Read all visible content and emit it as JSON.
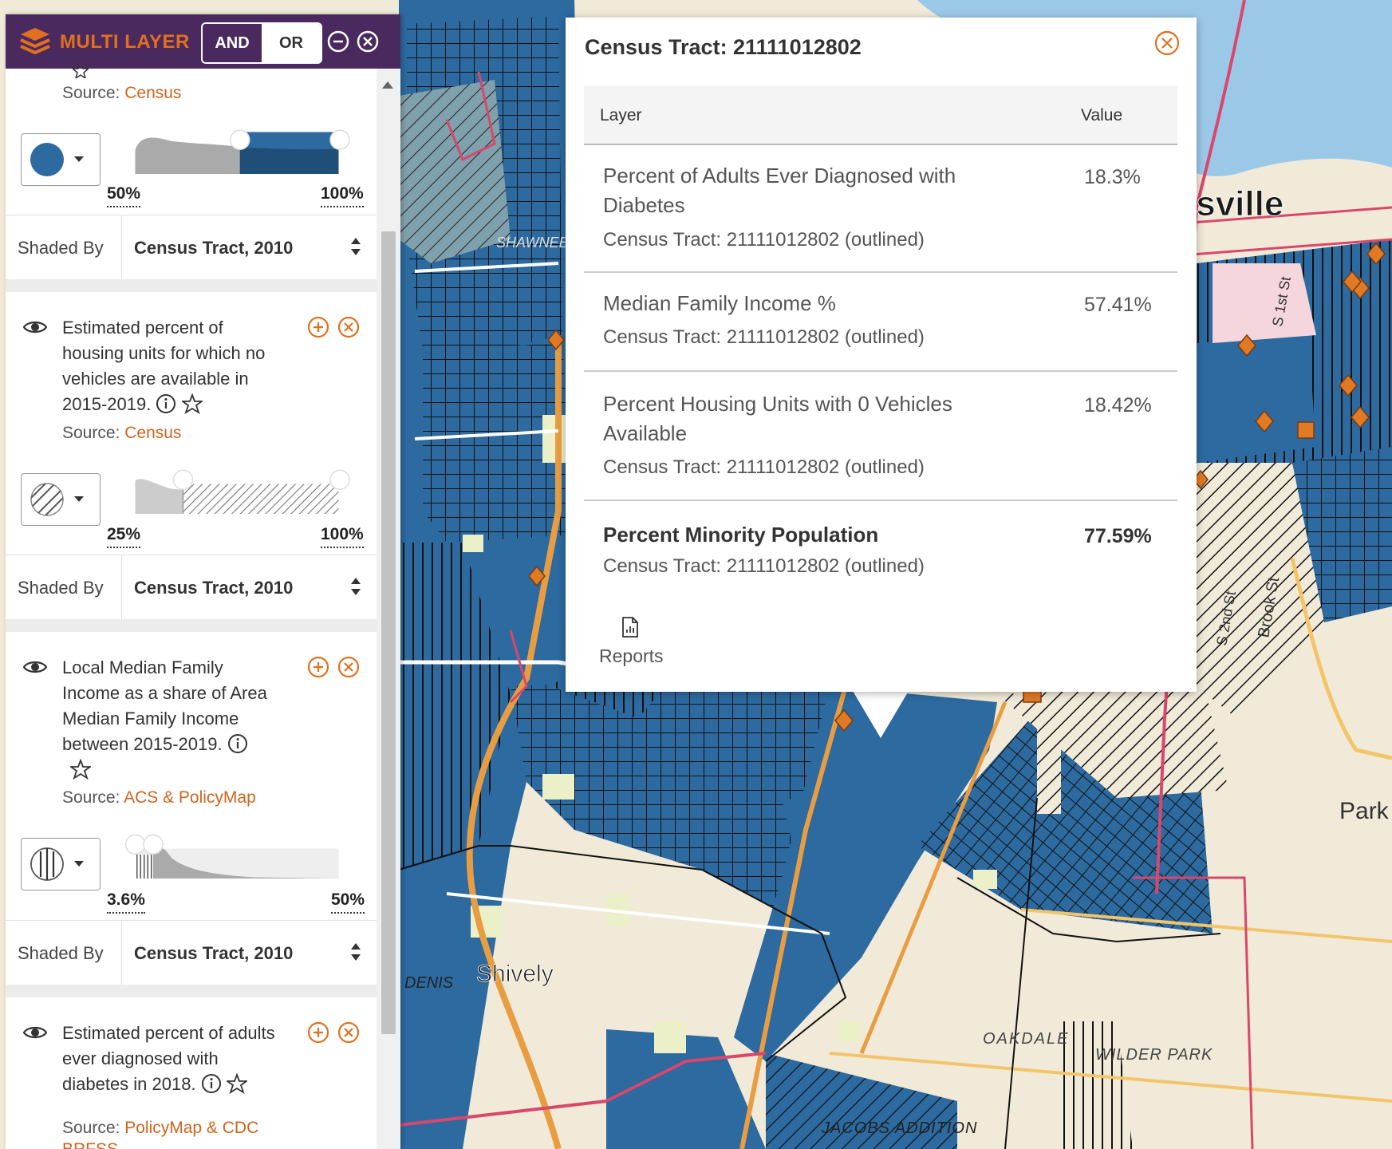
{
  "header": {
    "title": "MULTI LAYER",
    "and_label": "AND",
    "or_label": "OR"
  },
  "layers": [
    {
      "source_prefix": "Source:",
      "source": "Census",
      "min_label": "50%",
      "max_label": "100%",
      "shaded_by_label": "Shaded By",
      "shaded_by_value": "Census Tract, 2010",
      "fill": "solid"
    },
    {
      "title": "Estimated percent of housing units for which no vehicles are available in 2015-2019.",
      "source_prefix": "Source:",
      "source": "Census",
      "min_label": "25%",
      "max_label": "100%",
      "shaded_by_label": "Shaded By",
      "shaded_by_value": "Census Tract, 2010",
      "fill": "diagonal-hatch"
    },
    {
      "title": "Local Median Family Income as a share of Area Median Family Income between 2015-2019.",
      "source_prefix": "Source:",
      "source": "ACS & PolicyMap",
      "min_label": "3.6%",
      "max_label": "50%",
      "shaded_by_label": "Shaded By",
      "shaded_by_value": "Census Tract, 2010",
      "fill": "vertical-lines"
    },
    {
      "title": "Estimated percent of adults ever diagnosed with diabetes in 2018.",
      "source_prefix": "Source:",
      "source": "PolicyMap & CDC BRFSS"
    }
  ],
  "popup": {
    "title": "Census Tract: 21111012802",
    "col_layer": "Layer",
    "col_value": "Value",
    "rows": [
      {
        "name": "Percent of Adults Ever Diagnosed with Diabetes",
        "sub": "Census Tract: 21111012802 (outlined)",
        "value": "18.3%"
      },
      {
        "name": "Median Family Income %",
        "sub": "Census Tract: 21111012802 (outlined)",
        "value": "57.41%"
      },
      {
        "name": "Percent Housing Units with 0 Vehicles Available",
        "sub": "Census Tract: 21111012802 (outlined)",
        "value": "18.42%"
      },
      {
        "name": "Percent Minority Population",
        "sub": "Census Tract: 21111012802 (outlined)",
        "value": "77.59%"
      }
    ],
    "reports_label": "Reports"
  },
  "map": {
    "labels": {
      "louisville": "isville",
      "shively": "Shively",
      "oakdale": "OAKDALE",
      "wilder_park": "WILDER PARK",
      "jacobs_addition": "JACOBS ADDITION",
      "denis": "DENIS",
      "park": "Park",
      "shawnee": "SHAWNEE",
      "brook_st": "Brook St",
      "s_1st_st": "S 1st St",
      "s_2nd_st": "S 2nd St"
    },
    "colors": {
      "tract_fill": "#2c6aa0",
      "land": "#f1ead8",
      "river": "#9cc8e8",
      "road_major": "#e89d42",
      "road_red": "#d9476a"
    }
  },
  "colors": {
    "header_bg": "#4a2a5e",
    "accent": "#e0701f",
    "tract_blue": "#2c6aa0"
  }
}
